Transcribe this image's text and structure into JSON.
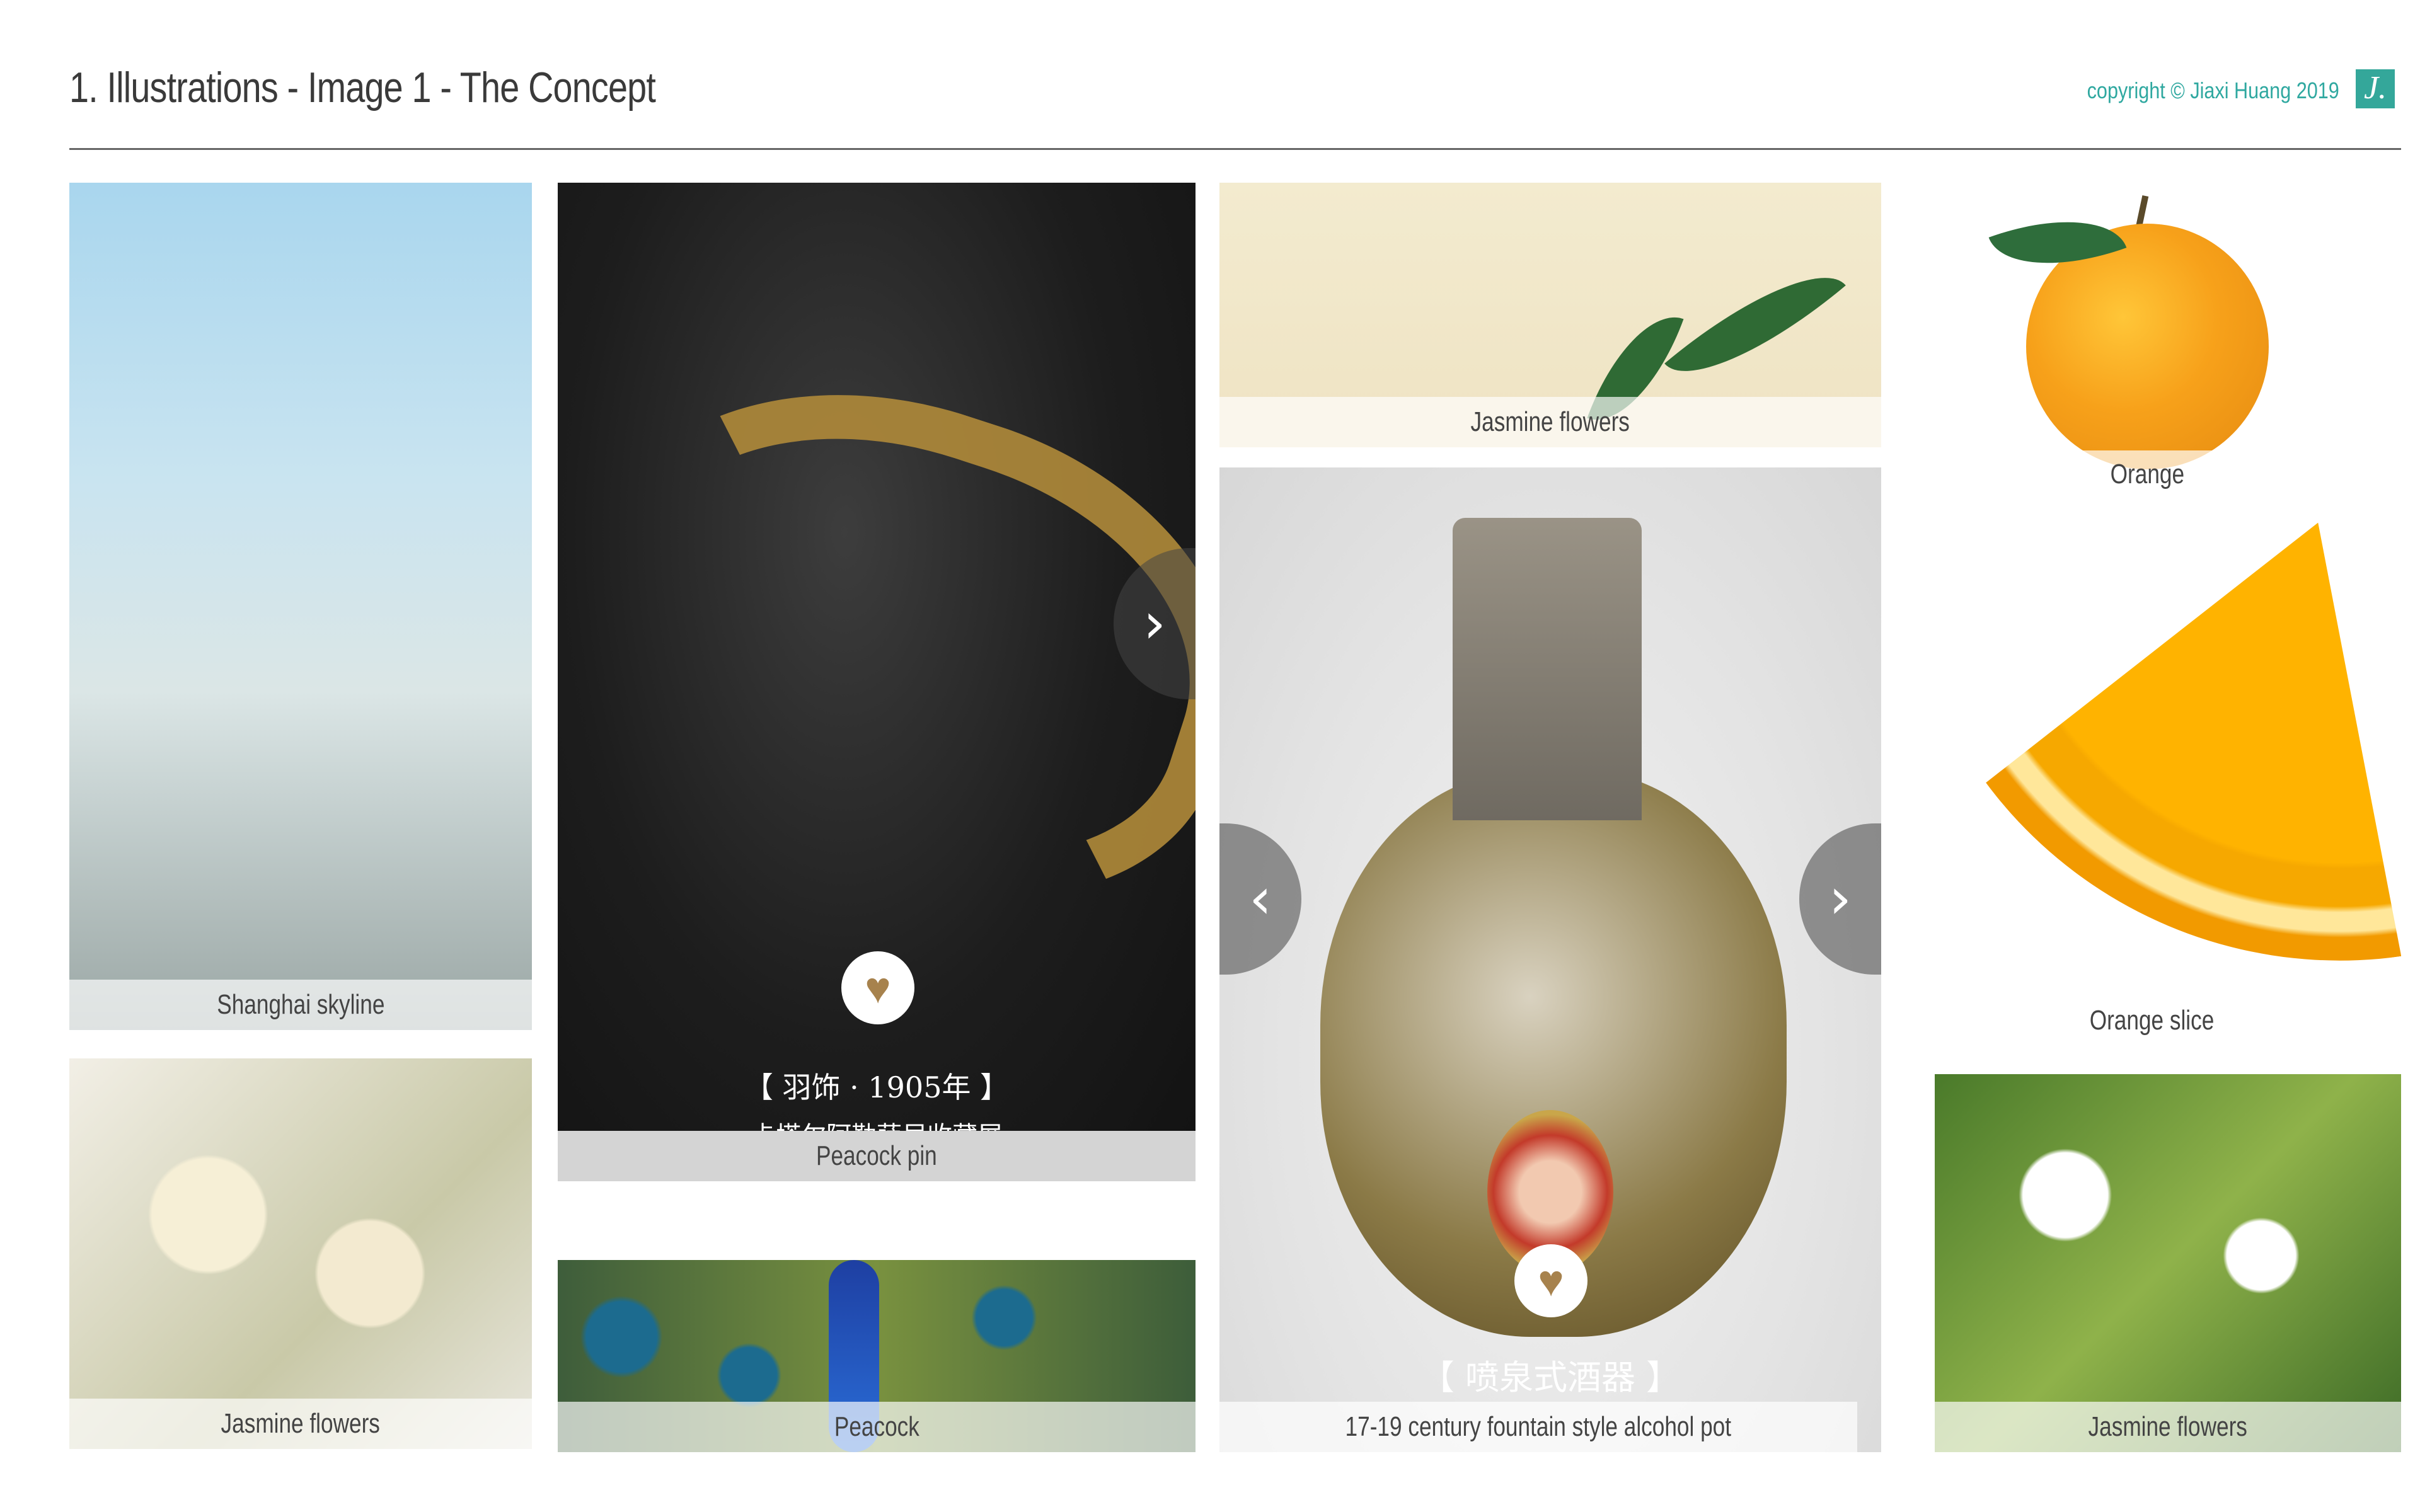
{
  "header": {
    "title": "1. Illustrations - Image 1 - The Concept",
    "copyright": "copyright © Jiaxi Huang 2019",
    "logo": "J."
  },
  "tiles": {
    "shanghai": {
      "caption": "Shanghai skyline"
    },
    "jasmine_buds": {
      "caption": "Jasmine flowers"
    },
    "peacock_pin": {
      "caption": "Peacock pin",
      "heading_cn": "【 羽饰 · 1905年 】",
      "subheading_cn": "卡塔尔阿勒萨尼收藏展",
      "next_icon": "›"
    },
    "peacock": {
      "caption": "Peacock"
    },
    "jasmine_illustration": {
      "caption": "Jasmine flowers"
    },
    "fountain_pot": {
      "caption": "17-19 century fountain style alcohol pot",
      "heading_cn": "【 喷泉式酒器 】",
      "prev_icon": "‹",
      "next_icon": "›"
    },
    "orange": {
      "caption": "Orange"
    },
    "orange_slice": {
      "caption": "Orange slice"
    },
    "jasmine_white": {
      "caption": "Jasmine flowers"
    }
  },
  "icons": {
    "heart": "♥"
  },
  "colors": {
    "accent": "#2fa8a0",
    "heart": "#a7824d"
  }
}
